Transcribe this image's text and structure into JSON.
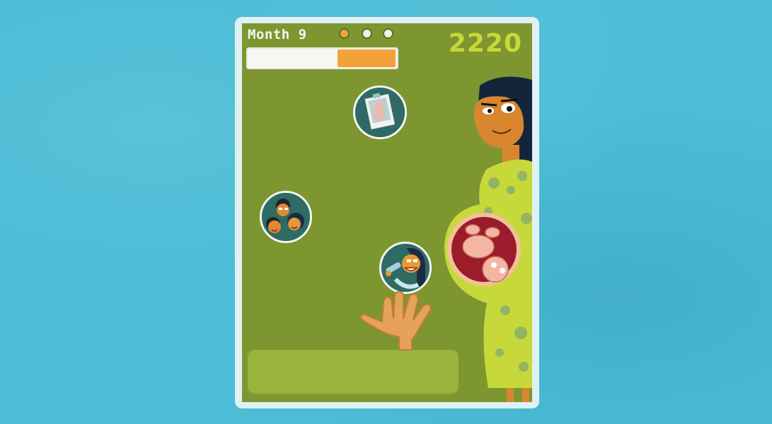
{
  "hud": {
    "month_label": "Month 9",
    "score": "2220",
    "lives": [
      {
        "state": "filled"
      },
      {
        "state": "empty"
      },
      {
        "state": "empty"
      }
    ],
    "progress_fraction": 0.38,
    "progress_color": "#f1a23b"
  },
  "bubbles": [
    {
      "name": "ultrasound-photo-bubble",
      "icon": "ultrasound-photo-icon"
    },
    {
      "name": "family-bubble",
      "icon": "family-icon"
    },
    {
      "name": "doctor-bubble",
      "icon": "doctor-icon"
    }
  ],
  "colors": {
    "background": "#4bbdd6",
    "screen": "#7e9630",
    "paddle": "#9ab43b",
    "score": "#c8d73a"
  }
}
